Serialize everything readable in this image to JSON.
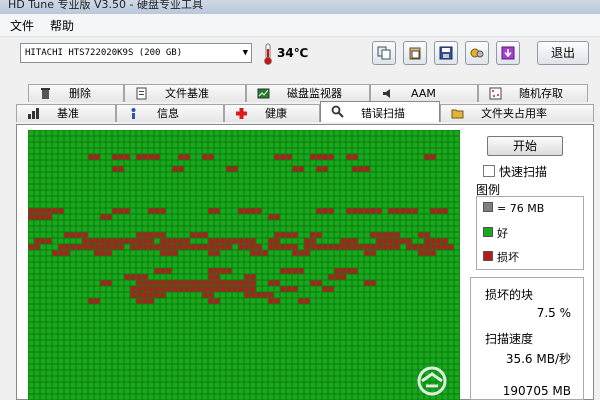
{
  "window": {
    "title": "HD Tune 专业版 V3.50 - 硬盘专业工具"
  },
  "menu": [
    {
      "label": "文件"
    },
    {
      "label": "帮助"
    }
  ],
  "toolbar": {
    "drive": "HITACHI HTS722020K9S (200 GB)",
    "temperature": "34℃",
    "exit_label": "退出",
    "buttons": [
      {
        "icon": "copy-icon"
      },
      {
        "icon": "paste-icon"
      },
      {
        "icon": "save-icon"
      },
      {
        "icon": "options-icon"
      },
      {
        "icon": "download-icon"
      }
    ]
  },
  "tabs": {
    "row1": [
      {
        "label": "删除",
        "icon": "trash-icon"
      },
      {
        "label": "文件基准",
        "icon": "file-benchmark-icon"
      },
      {
        "label": "磁盘监视器",
        "icon": "disk-monitor-icon"
      },
      {
        "label": "AAM",
        "icon": "speaker-icon"
      },
      {
        "label": "随机存取",
        "icon": "random-access-icon"
      }
    ],
    "row2": [
      {
        "label": "基准",
        "icon": "benchmark-icon"
      },
      {
        "label": "信息",
        "icon": "info-icon"
      },
      {
        "label": "健康",
        "icon": "health-icon"
      },
      {
        "label": "错误扫描",
        "icon": "error-scan-icon",
        "active": true
      },
      {
        "label": "文件夹占用率",
        "icon": "folder-usage-icon"
      }
    ]
  },
  "scan": {
    "start_label": "开始",
    "quick_scan_label": "快速扫描",
    "legend_title": "图例",
    "legend": [
      {
        "label": "= 76 MB",
        "color": "#808080"
      },
      {
        "label": "好",
        "color": "#18a81c"
      },
      {
        "label": "损坏",
        "color": "#b01e1e"
      }
    ],
    "damaged_label": "损坏的块",
    "damaged_value": "7.5 %",
    "speed_label": "扫描速度",
    "speed_value": "35.6 MB/秒",
    "position_value": "190705 MB"
  },
  "colors": {
    "good": "#18a81c",
    "bad": "#b01e1e",
    "grid_line": "#0e7a12"
  }
}
